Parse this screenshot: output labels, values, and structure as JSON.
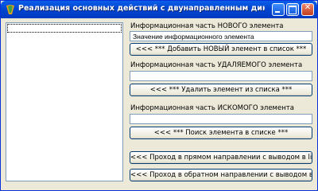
{
  "window": {
    "title": "Реализация основных действий с двунаправленным динамическим списком",
    "icon": "app-logo-icon",
    "minimize_glyph": "minimize-icon",
    "maximize_glyph": "maximize-icon",
    "close_glyph": "✕"
  },
  "list": {
    "items": []
  },
  "add_section": {
    "label": "Информационная часть НОВОГО элемента",
    "value": "Значение информационного элемента",
    "button": "<<< *** Добавить НОВЫЙ элемент в список *** "
  },
  "delete_section": {
    "label": "Информационная часть УДАЛЯЕМОГО элемента",
    "value": "",
    "button": "<<< *** Удалить элемент из списка ***"
  },
  "search_section": {
    "label": "Информационная часть ИСКОМОГО элемента",
    "value": "",
    "button": "<<< *** Поиск элемента в списке ***"
  },
  "traverse": {
    "forward_button": "<<< Проход в прямом направлении с выводом в listbox",
    "backward_button": "<<< Проход в обратном направлении с выводом в listbox"
  }
}
